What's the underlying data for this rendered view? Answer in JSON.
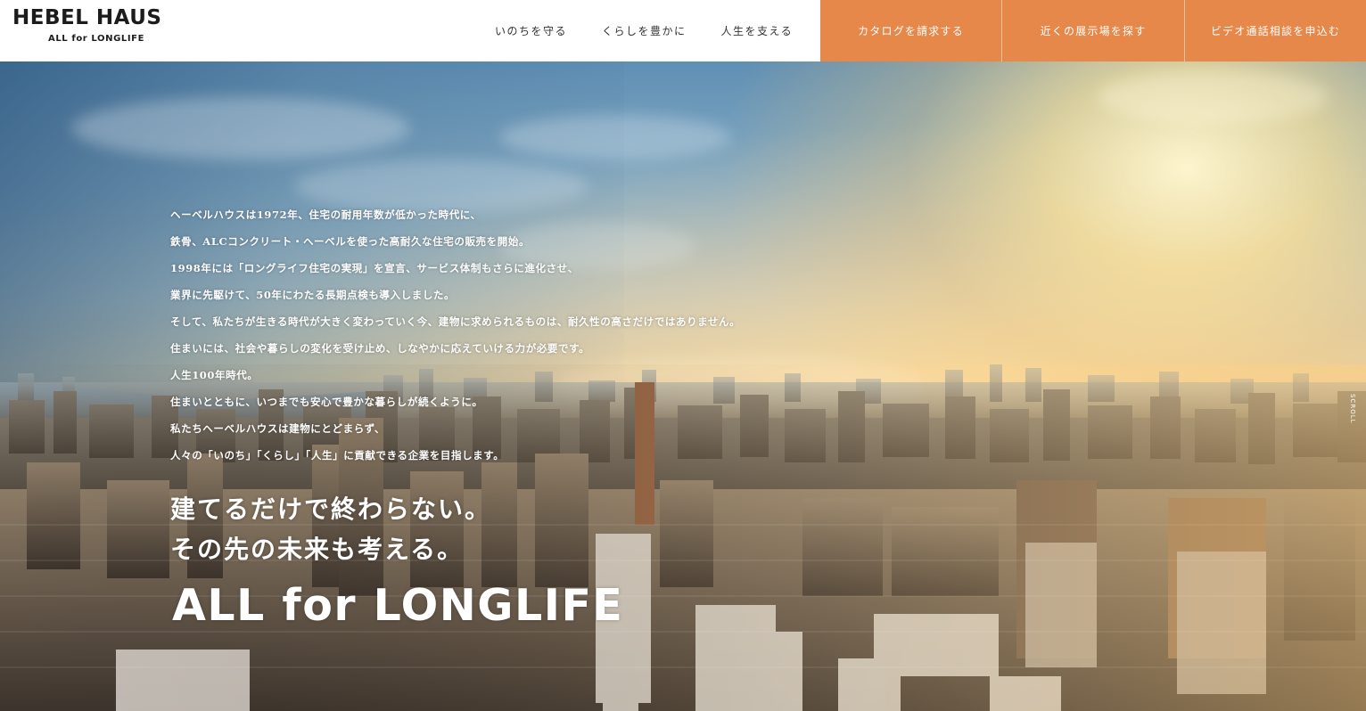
{
  "header": {
    "logo": {
      "main": "HEBEL HAUS",
      "sub": "ALL for LONGLIFE"
    },
    "nav": [
      {
        "label": "いのちを守る"
      },
      {
        "label": "くらしを豊かに"
      },
      {
        "label": "人生を支える"
      }
    ],
    "cta": [
      {
        "label": "カタログを請求する"
      },
      {
        "label": "近くの展示場を探す"
      },
      {
        "label": "ビデオ通話相談を申込む"
      }
    ],
    "colors": {
      "cta_background": "#e5884a",
      "header_background": "#ffffff",
      "logo_text": "#1c1c1c"
    }
  },
  "hero": {
    "intro_lines": [
      "ヘーベルハウスは1972年、住宅の耐用年数が低かった時代に、",
      "鉄骨、ALCコンクリート・ヘーベルを使った高耐久な住宅の販売を開始。",
      "1998年には「ロングライフ住宅の実現」を宣言、サービス体制もさらに進化させ、",
      "業界に先駆けて、50年にわたる長期点検も導入しました。",
      "そして、私たちが生きる時代が大きく変わっていく今、建物に求められるものは、耐久性の高さだけではありません。",
      "住まいには、社会や暮らしの変化を受け止め、しなやかに応えていける力が必要です。",
      "人生100年時代。",
      "住まいとともに、いつまでも安心で豊かな暮らしが続くように。",
      "私たちヘーベルハウスは建物にとどまらず、",
      "人々の「いのち」「くらし」「人生」に貢献できる企業を目指します。"
    ],
    "catch_lines": [
      "建てるだけで終わらない。",
      "その先の未来も考える。"
    ],
    "tagline": "ALL for LONGLIFE",
    "scroll_label": "SCROLL",
    "background_description_icon": "city-skyline-sunrise-photo"
  }
}
